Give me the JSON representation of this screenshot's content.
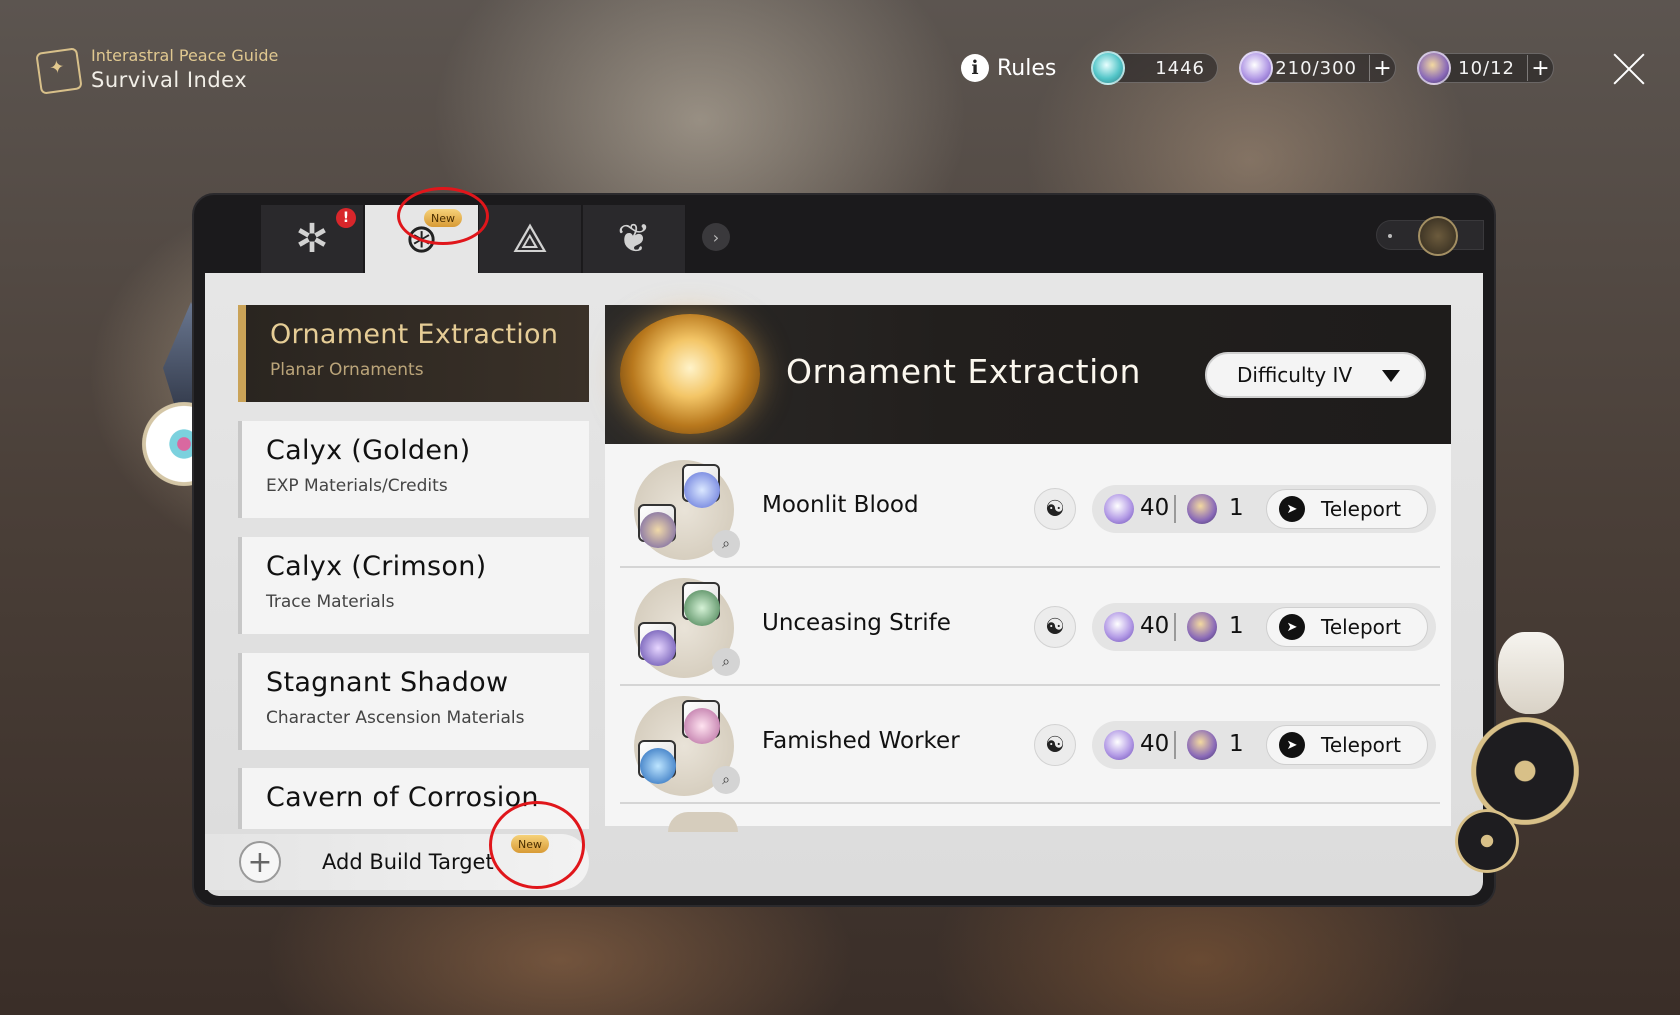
{
  "header": {
    "subtitle": "Interastral Peace Guide",
    "title": "Survival Index",
    "rules_label": "Rules",
    "currencies": [
      {
        "icon": "stellar-jade-icon",
        "value": "1446"
      },
      {
        "icon": "trailblaze-power-icon",
        "value": "210/300",
        "plus": "+"
      },
      {
        "icon": "reserve-power-icon",
        "value": "10/12",
        "plus": "+"
      }
    ]
  },
  "tabs": {
    "alert": "!",
    "new_badge": "New",
    "arrow": "›"
  },
  "categories": [
    {
      "title": "Ornament Extraction",
      "subtitle": "Planar Ornaments"
    },
    {
      "title": "Calyx (Golden)",
      "subtitle": "EXP Materials/Credits"
    },
    {
      "title": "Calyx (Crimson)",
      "subtitle": "Trace Materials"
    },
    {
      "title": "Stagnant Shadow",
      "subtitle": "Character Ascension Materials"
    },
    {
      "title": "Cavern of Corrosion"
    }
  ],
  "add_build": {
    "label": "Add Build Target",
    "plus": "+",
    "new_badge": "New"
  },
  "banner": {
    "title": "Ornament Extraction",
    "difficulty": "Difficulty IV"
  },
  "domains": [
    {
      "name": "Moonlit Blood",
      "cost_power": "40",
      "cost_reserve": "1",
      "action": "Teleport"
    },
    {
      "name": "Unceasing Strife",
      "cost_power": "40",
      "cost_reserve": "1",
      "action": "Teleport"
    },
    {
      "name": "Famished Worker",
      "cost_power": "40",
      "cost_reserve": "1",
      "action": "Teleport"
    }
  ],
  "icons": {
    "zoom": "⌕",
    "boss": "☯",
    "teleport": "➤",
    "rules": "i"
  },
  "colors": {
    "accent_gold": "#caa358",
    "annotation_red": "#e0161b",
    "alert_red": "#d8262b"
  }
}
